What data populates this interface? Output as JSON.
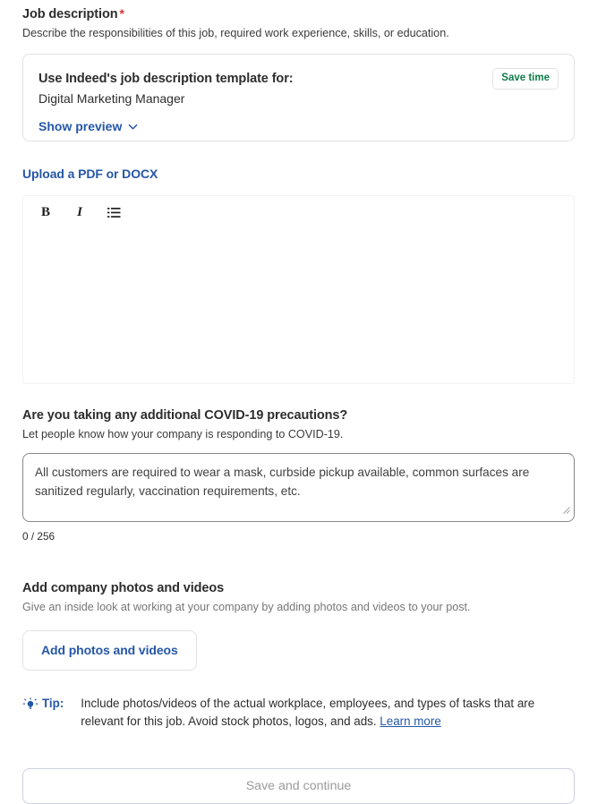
{
  "job_description": {
    "title": "Job description",
    "required_marker": "*",
    "subtitle": "Describe the responsibilities of this job, required work experience, skills, or education.",
    "template_card": {
      "heading": "Use Indeed's job description template for:",
      "role": "Digital Marketing Manager",
      "show_preview_label": "Show preview",
      "chevron_icon": "chevron-down-icon",
      "save_time_badge": "Save time"
    },
    "upload_link": "Upload a PDF or DOCX",
    "editor": {
      "bold_icon": "B",
      "italic_icon": "I",
      "list_icon": "bulleted-list-icon",
      "content": ""
    }
  },
  "covid": {
    "title": "Are you taking any additional COVID-19 precautions?",
    "subtitle": "Let people know how your company is responding to COVID-19.",
    "placeholder": "All customers are required to wear a mask, curbside pickup available, common surfaces are sanitized regularly, vaccination requirements, etc.",
    "value": "",
    "counter": "0 / 256"
  },
  "photos": {
    "title": "Add company photos and videos",
    "subtitle": "Give an inside look at working at your company by adding photos and videos to your post.",
    "button_label": "Add photos and videos"
  },
  "tip": {
    "icon": "lightbulb-icon",
    "label": "Tip:",
    "text": "Include photos/videos of the actual workplace, employees, and types of tasks that are relevant for this job. Avoid stock photos, logos, and ads.",
    "learn_more": "Learn more"
  },
  "footer": {
    "save_and_continue": "Save and continue"
  },
  "colors": {
    "link_blue": "#2557a7",
    "badge_green": "#0d7c4a",
    "required_red": "#d4343a",
    "text_dark": "#2d2d2d",
    "text_muted": "#767676",
    "border_light": "#e4e2e0",
    "disabled_text": "#9b9b9b"
  }
}
